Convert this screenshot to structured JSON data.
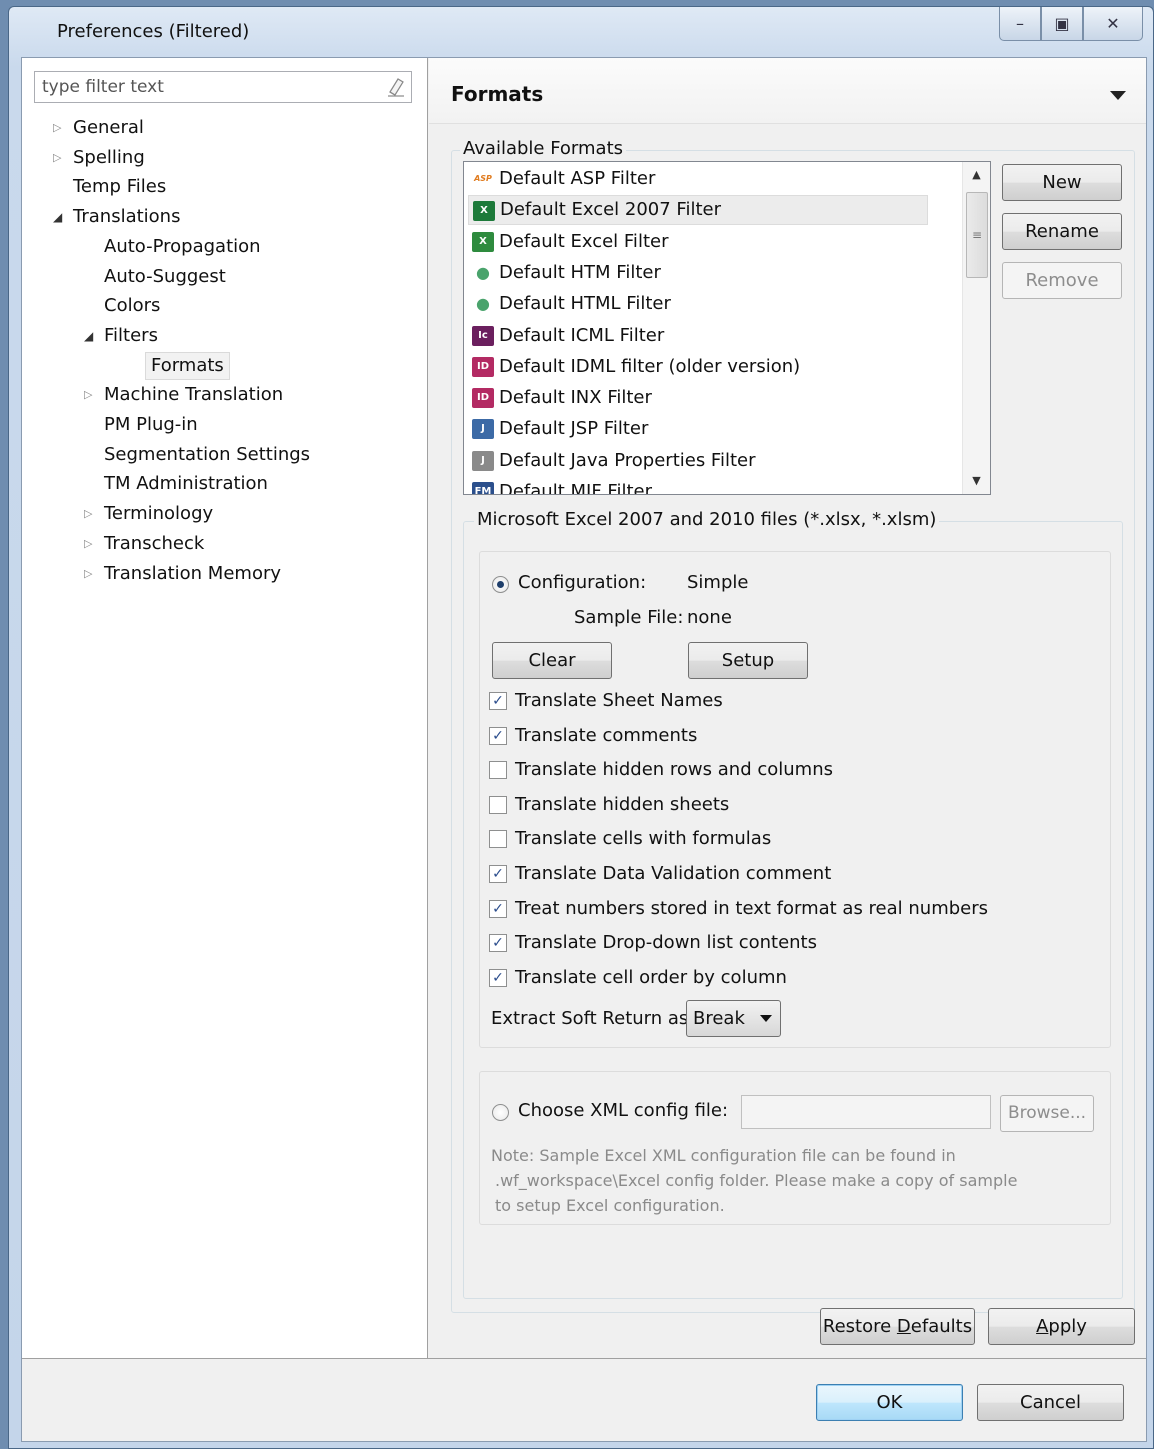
{
  "window": {
    "title": "Preferences (Filtered)"
  },
  "window_controls": {
    "minimize": "–",
    "maximize": "▣",
    "close": "✕"
  },
  "filter": {
    "placeholder": "type filter text"
  },
  "tree": [
    {
      "label": "General",
      "toggle": "▷"
    },
    {
      "label": "Spelling",
      "toggle": "▷"
    },
    {
      "label": "Temp Files",
      "toggle": ""
    },
    {
      "label": "Translations",
      "toggle": "◢"
    },
    {
      "label": "Auto-Propagation",
      "toggle": ""
    },
    {
      "label": "Auto-Suggest",
      "toggle": ""
    },
    {
      "label": "Colors",
      "toggle": ""
    },
    {
      "label": "Filters",
      "toggle": "◢"
    },
    {
      "label": "Formats",
      "toggle": ""
    },
    {
      "label": "Machine Translation",
      "toggle": "▷"
    },
    {
      "label": "PM Plug-in",
      "toggle": ""
    },
    {
      "label": "Segmentation Settings",
      "toggle": ""
    },
    {
      "label": "TM Administration",
      "toggle": ""
    },
    {
      "label": "Terminology",
      "toggle": "▷"
    },
    {
      "label": "Transcheck",
      "toggle": "▷"
    },
    {
      "label": "Translation Memory",
      "toggle": "▷"
    }
  ],
  "page": {
    "title": "Formats"
  },
  "available_formats": {
    "label": "Available Formats",
    "items": [
      {
        "label": "Default ASP Filter",
        "icon": "asp-icon",
        "glyph": "ASP",
        "color": "#e07b1e"
      },
      {
        "label": "Default Excel 2007 Filter",
        "icon": "excel-2007-icon",
        "glyph": "X",
        "color": "#1d7a3a"
      },
      {
        "label": "Default Excel Filter",
        "icon": "excel-icon",
        "glyph": "X",
        "color": "#2e8b3e"
      },
      {
        "label": "Default HTM Filter",
        "icon": "globe-icon",
        "glyph": "●",
        "color": "#4aa36c"
      },
      {
        "label": "Default HTML Filter",
        "icon": "globe-icon",
        "glyph": "●",
        "color": "#4aa36c"
      },
      {
        "label": "Default ICML Filter",
        "icon": "incopy-icon",
        "glyph": "Ic",
        "color": "#6b1f5e"
      },
      {
        "label": "Default IDML filter (older version)",
        "icon": "indesign-icon",
        "glyph": "ID",
        "color": "#b32a63"
      },
      {
        "label": "Default INX Filter",
        "icon": "indesign-icon",
        "glyph": "ID",
        "color": "#b32a63"
      },
      {
        "label": "Default JSP Filter",
        "icon": "jsp-icon",
        "glyph": "J",
        "color": "#3c6aa6"
      },
      {
        "label": "Default Java Properties Filter",
        "icon": "properties-file-icon",
        "glyph": "J",
        "color": "#8a8a8a"
      },
      {
        "label": "Default MIF Filter",
        "icon": "framemaker-icon",
        "glyph": "FM",
        "color": "#2b4f8c"
      }
    ],
    "buttons": {
      "new": "New",
      "rename": "Rename",
      "remove": "Remove"
    }
  },
  "excel": {
    "group_label": "Microsoft Excel 2007 and 2010 files (*.xlsx, *.xlsm)",
    "configuration_label": "Configuration:",
    "configuration_value": "Simple",
    "sample_file_label": "Sample File:",
    "sample_file_value": "none",
    "clear": "Clear",
    "setup": "Setup",
    "options": [
      {
        "label": "Translate Sheet Names",
        "checked": true
      },
      {
        "label": "Translate comments",
        "checked": true
      },
      {
        "label": "Translate hidden rows and columns",
        "checked": false
      },
      {
        "label": "Translate hidden sheets",
        "checked": false
      },
      {
        "label": "Translate cells with formulas",
        "checked": false
      },
      {
        "label": "Translate Data Validation comment",
        "checked": true
      },
      {
        "label": "Treat numbers stored in text format as real numbers",
        "checked": true
      },
      {
        "label": "Translate Drop-down list contents",
        "checked": true
      },
      {
        "label": "Translate cell order by column",
        "checked": true
      }
    ],
    "soft_return_label": "Extract Soft Return as:",
    "soft_return_value": "Break",
    "xml_label": "Choose XML config file:",
    "xml_value": "",
    "browse": "Browse...",
    "note_lines": [
      "Note: Sample Excel XML configuration file can be found in",
      ".wf_workspace\\Excel config folder. Please make a copy of sample",
      "to setup Excel configuration."
    ]
  },
  "actions": {
    "restore_pre": "Restore ",
    "restore_u": "D",
    "restore_post": "efaults",
    "apply_u": "A",
    "apply_post": "pply",
    "ok": "OK",
    "cancel": "Cancel"
  },
  "colors": {
    "checkmark": "#2a4c8c",
    "default_button_border": "#3c7fb1"
  }
}
